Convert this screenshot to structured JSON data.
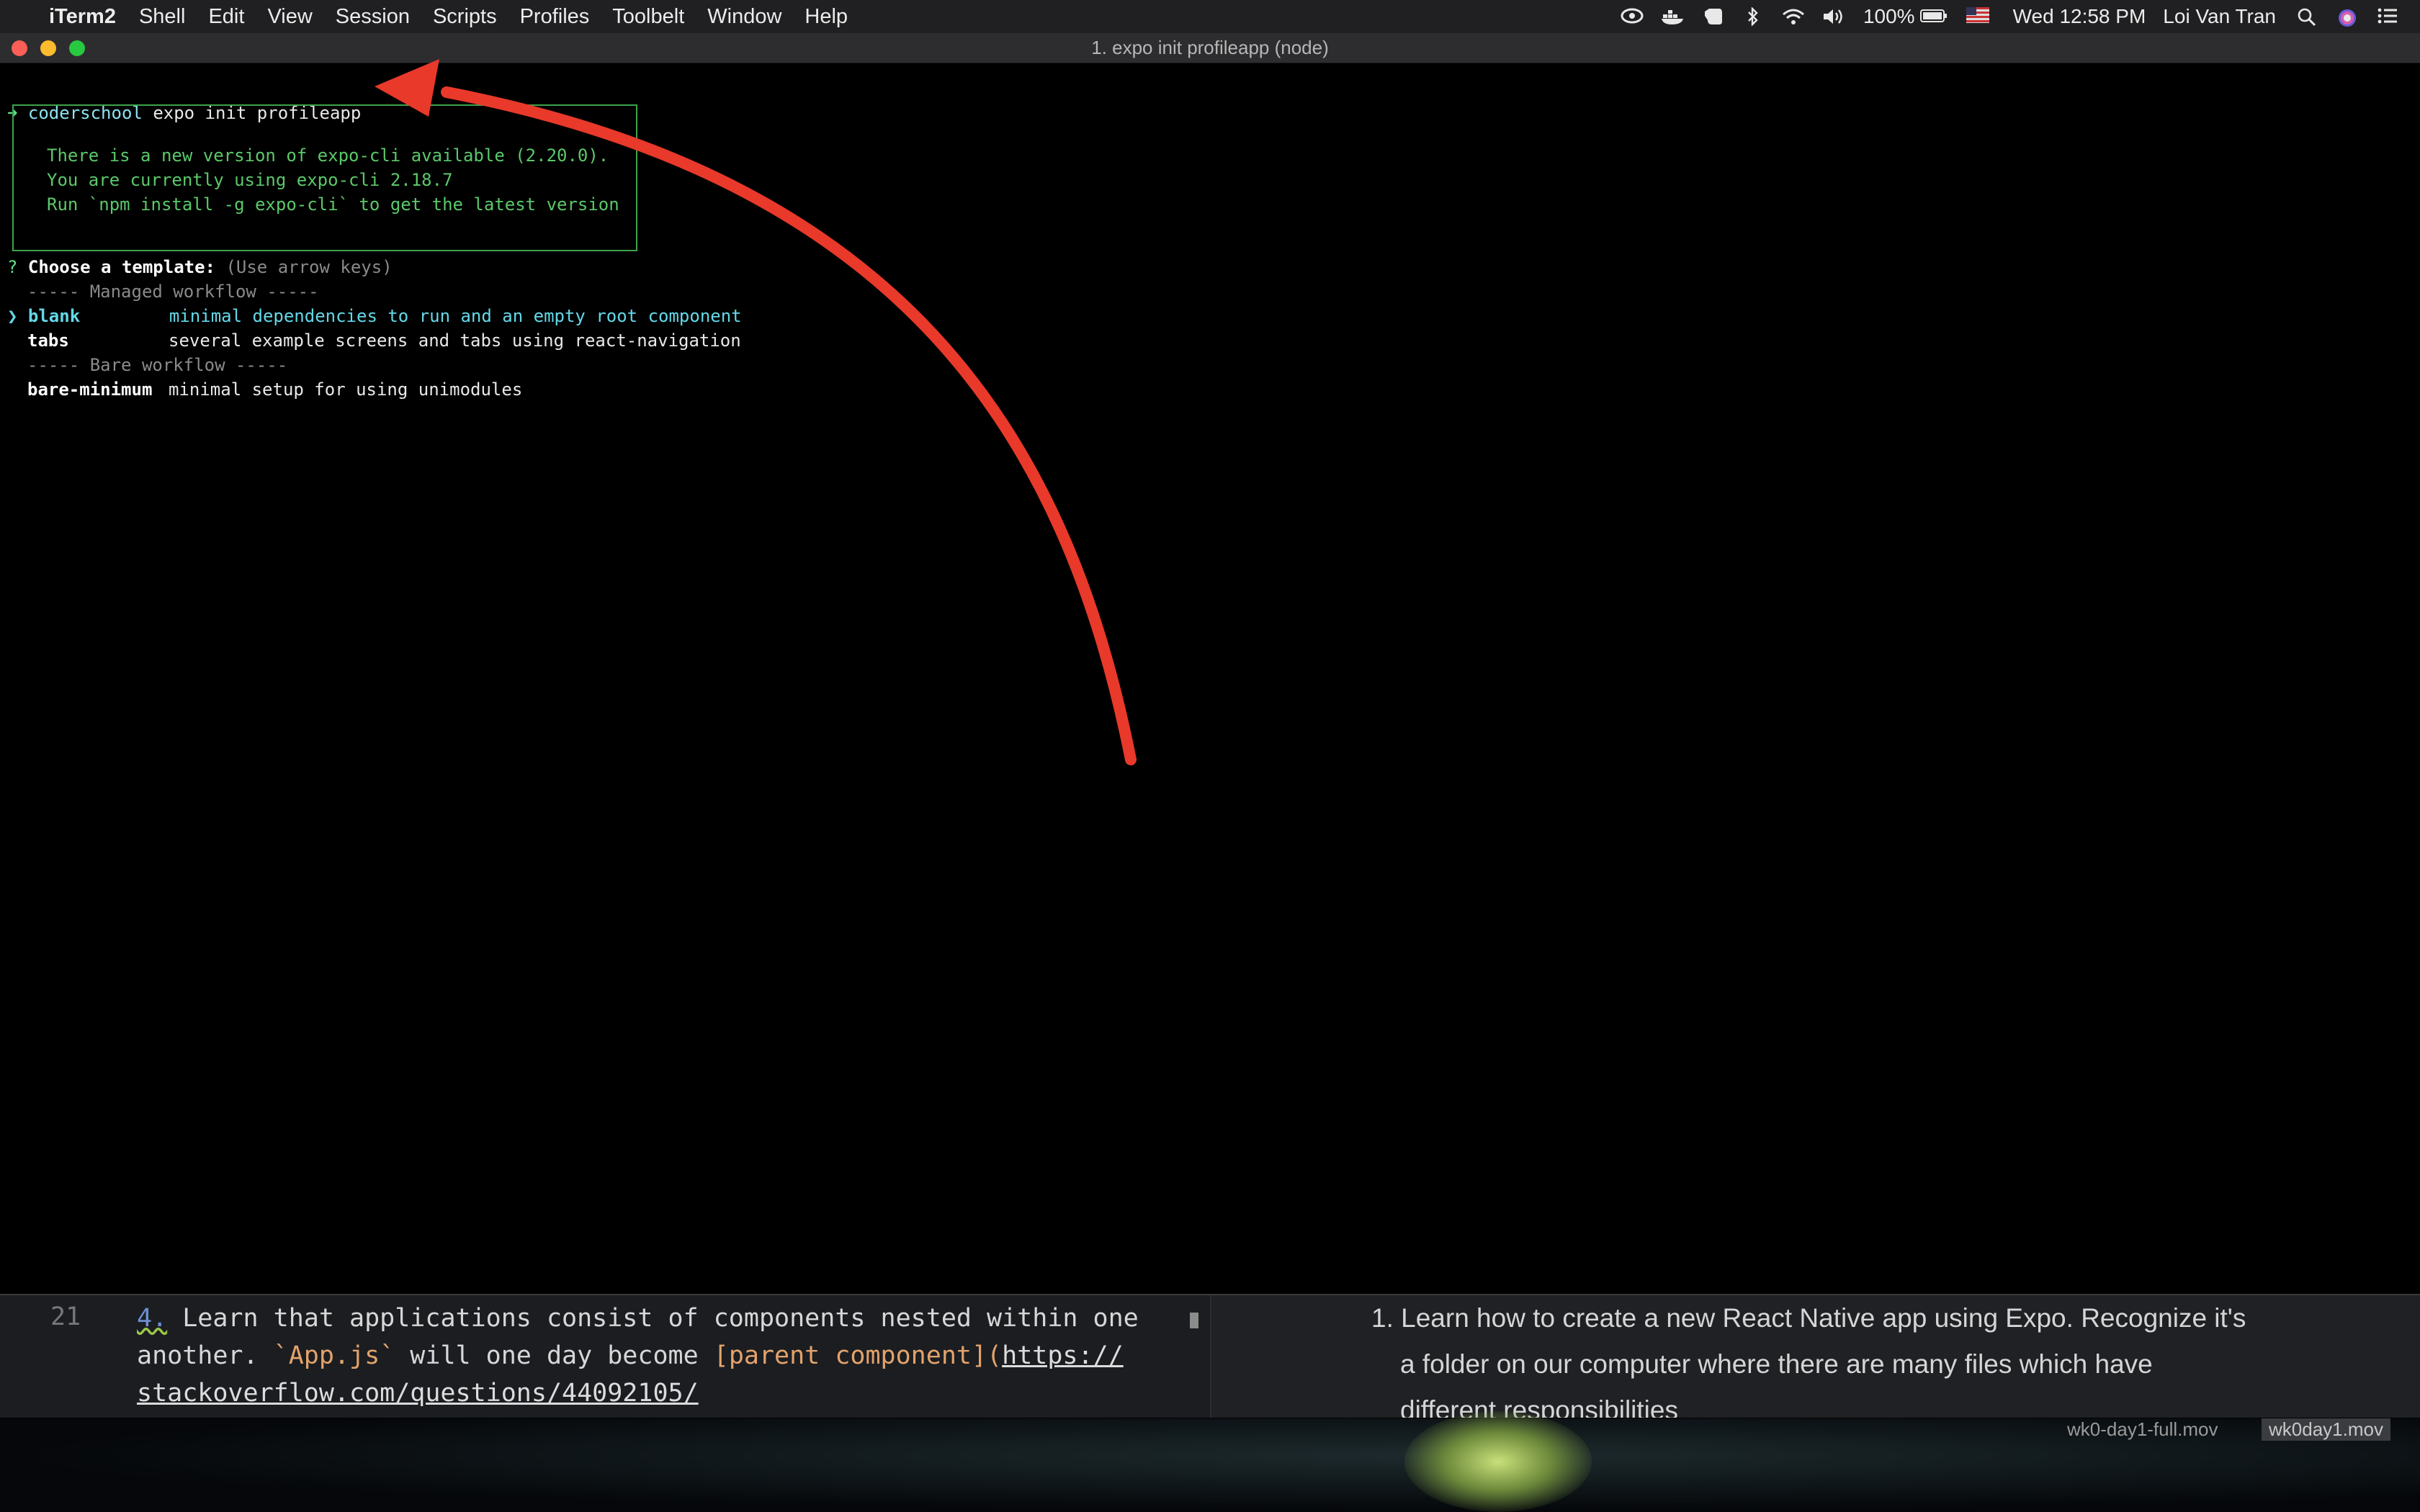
{
  "menubar": {
    "apple_glyph": "",
    "app_name": "iTerm2",
    "items": [
      "Shell",
      "Edit",
      "View",
      "Session",
      "Scripts",
      "Profiles",
      "Toolbelt",
      "Window",
      "Help"
    ],
    "status_icons": [
      "creative-cloud-icon",
      "docker-icon",
      "evernote-icon",
      "bluetooth-icon",
      "wifi-icon",
      "volume-icon"
    ],
    "battery": "100%",
    "clock": "Wed 12:58 PM",
    "user": "Loi Van Tran"
  },
  "window": {
    "title": "1. expo init profileapp (node)"
  },
  "terminal": {
    "prompt_arrow": "➜",
    "prompt_dir": "coderschool",
    "command": "expo init profileapp",
    "update_box": [
      "There is a new version of expo-cli available (2.20.0).",
      "You are currently using expo-cli 2.18.7",
      "Run `npm install -g expo-cli` to get the latest version"
    ],
    "question_mark": "?",
    "question": "Choose a template:",
    "hint": "(Use arrow keys)",
    "managed_header": "----- Managed workflow -----",
    "bare_header": "----- Bare workflow -----",
    "cursor": "❯",
    "options": [
      {
        "name": "blank",
        "desc": "minimal dependencies to run and an empty root component"
      },
      {
        "name": "tabs",
        "desc": "several example screens and tabs using react-navigation"
      },
      {
        "name": "bare-minimum",
        "desc": "minimal setup for using unimodules"
      }
    ]
  },
  "editor": {
    "line_number": "21",
    "line1_num": "4.",
    "line1_text": " Learn that applications consist of components nested within one",
    "line2_pre": "another. ",
    "line2_code": "`App.js`",
    "line2_mid": " will one day become ",
    "line2_link": "[parent component]",
    "line2_paren": "(",
    "line2_url": "https://",
    "line3_url": "stackoverflow.com/questions/44092105/"
  },
  "preview": {
    "lines": [
      "1. Learn how to create a new React Native app using Expo. Recognize it's",
      "a folder on our computer where there are many files which have",
      "different responsibilities"
    ]
  },
  "desktop": {
    "file_label": "wk0-day1-full.mov",
    "file_label2": "wk0day1.mov"
  },
  "colors": {
    "annotation_arrow": "#e8392a",
    "terminal_bg": "#000000",
    "update_box_border": "#3ea34a",
    "selected_option": "#64d8e8"
  }
}
